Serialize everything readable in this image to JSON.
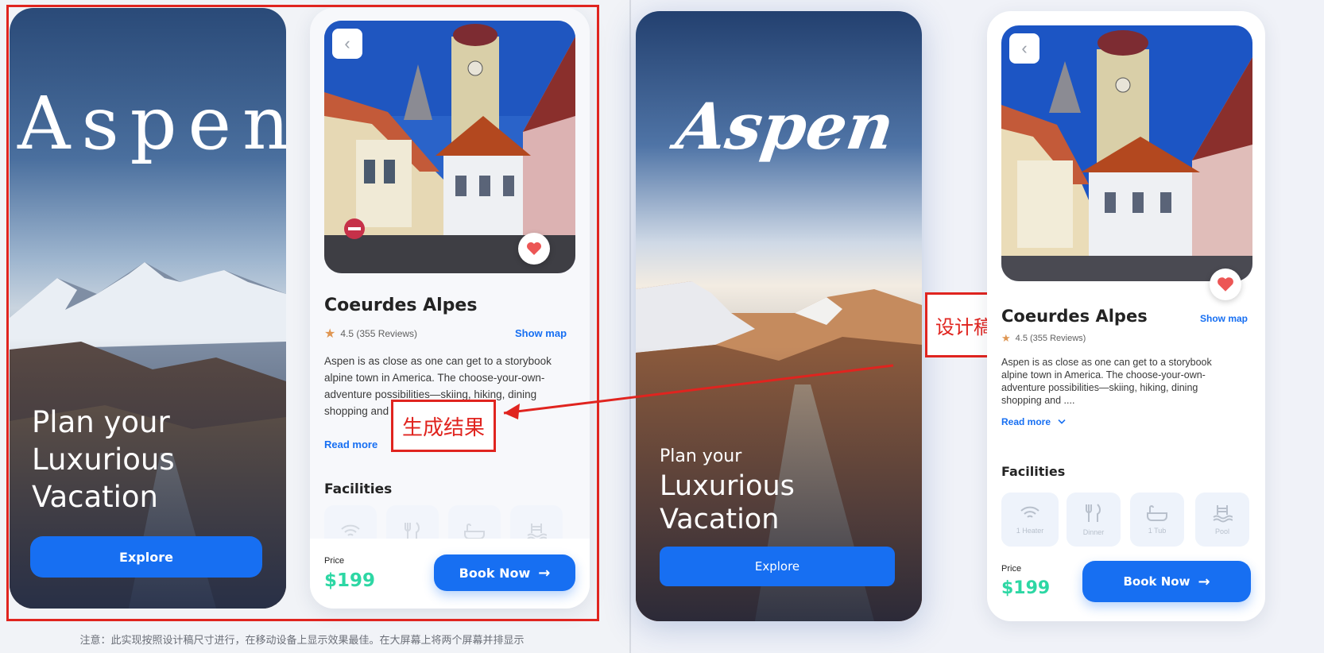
{
  "splash": {
    "title": "Aspen",
    "plan": "Plan your",
    "luxurious": "Luxurious",
    "vacation": "Vacation",
    "explore_label": "Explore"
  },
  "detail": {
    "place_title": "Coeurdes Alpes",
    "rating_text": "4.5 (355 Reviews)",
    "show_map_label": "Show map",
    "description_left": "Aspen is as close as one can get to a storybook alpine town in America. The choose-your-own-adventure possibilities—skiing, hiking, dining shopping and ....",
    "description_right": "Aspen is as close as one can get to a storybook alpine town in America. The choose-your-own-adventure possibilities—skiing, hiking, dining shopping and ....",
    "read_more_label": "Read more",
    "facilities_title": "Facilities",
    "facilities": [
      {
        "label": "1 Heater",
        "icon": "wifi-heater-icon"
      },
      {
        "label": "Dinner",
        "icon": "dinner-icon"
      },
      {
        "label": "1 Tub",
        "icon": "bathtub-icon"
      },
      {
        "label": "Pool",
        "icon": "pool-icon"
      }
    ],
    "price_label": "Price",
    "price_value": "$199",
    "book_label": "Book Now"
  },
  "annotations": {
    "generated_label": "生成结果",
    "design_label": "设计稿",
    "note": "注意：此实现按照设计稿尺寸进行，在移动设备上显示效果最佳。在大屏幕上将两个屏幕并排显示"
  },
  "colors": {
    "accent": "#176ff2",
    "price": "#2dd7a4",
    "star": "#df9652",
    "heart": "#ec5655",
    "annotation": "#e0241f"
  }
}
